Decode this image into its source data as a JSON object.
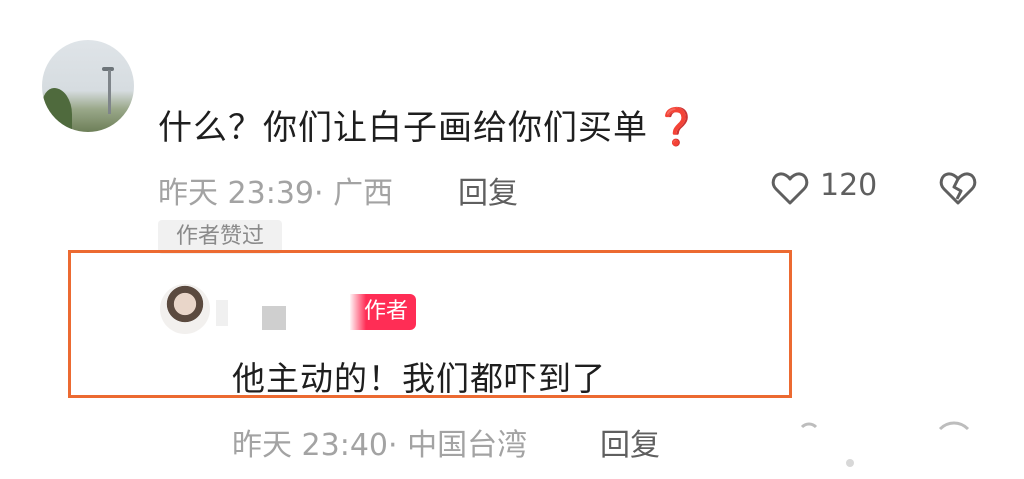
{
  "comment": {
    "text": "什么？你们让白子画给你们买单",
    "emoji": "❓",
    "timestamp": "昨天 23:39· 广西",
    "reply_label": "回复",
    "like_count": "120",
    "author_liked_badge": "作者赞过"
  },
  "reply": {
    "author_tag": "作者",
    "text": "他主动的！我们都吓到了",
    "timestamp": "昨天 23:40· 中国台湾",
    "reply_label": "回复"
  },
  "colors": {
    "highlight_border": "#ec6a31",
    "author_tag_bg": "#ff2d55",
    "question_mark": "#d51c1c"
  },
  "icons": [
    "heart-icon",
    "broken-heart-icon"
  ]
}
